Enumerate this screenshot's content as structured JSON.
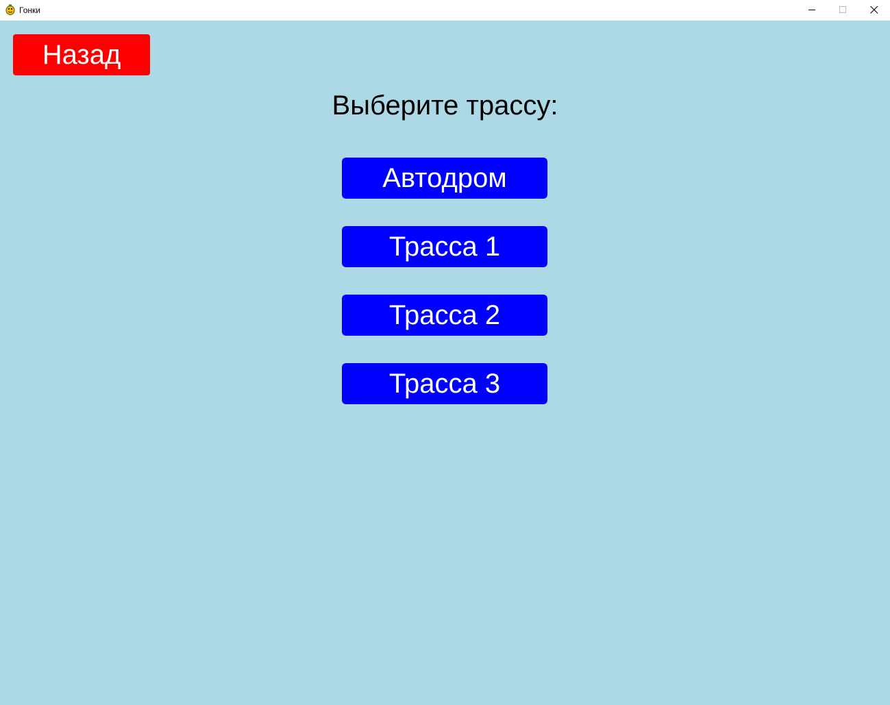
{
  "window": {
    "title": "Гонки",
    "icon": "pygame-snake-icon"
  },
  "screen": {
    "back_label": "Назад",
    "heading": "Выберите трассу:",
    "tracks": [
      {
        "label": "Автодром"
      },
      {
        "label": "Трасса 1"
      },
      {
        "label": "Трасса 2"
      },
      {
        "label": "Трасса 3"
      }
    ]
  },
  "colors": {
    "background": "#add8e6",
    "back_button": "#ff0000",
    "track_button": "#0000ff",
    "button_text": "#ffffff"
  }
}
